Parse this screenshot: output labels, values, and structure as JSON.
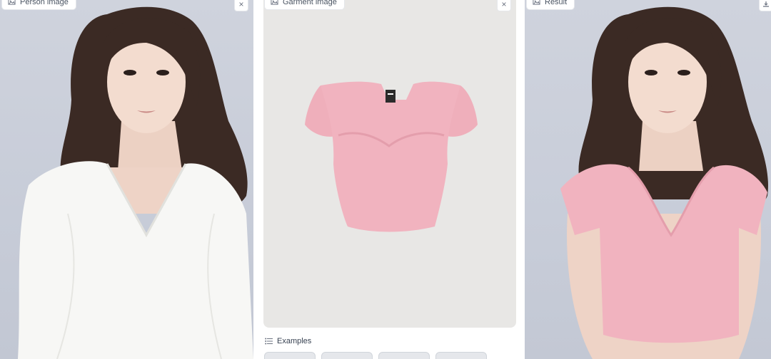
{
  "panels": {
    "person": {
      "label": "Person image",
      "close_icon": "×"
    },
    "garment": {
      "label": "Garment image",
      "close_icon": "×"
    },
    "result": {
      "label": "Result",
      "download_icon": "download-icon"
    }
  },
  "examples": {
    "label": "Examples",
    "thumbnail_count": 4
  },
  "colors": {
    "background_studio": "#c9cdd8",
    "garment_pink": "#f1b3bf",
    "blouse_white": "#f7f7f5",
    "hair": "#3b2a24",
    "skin": "#f1d9cc"
  }
}
